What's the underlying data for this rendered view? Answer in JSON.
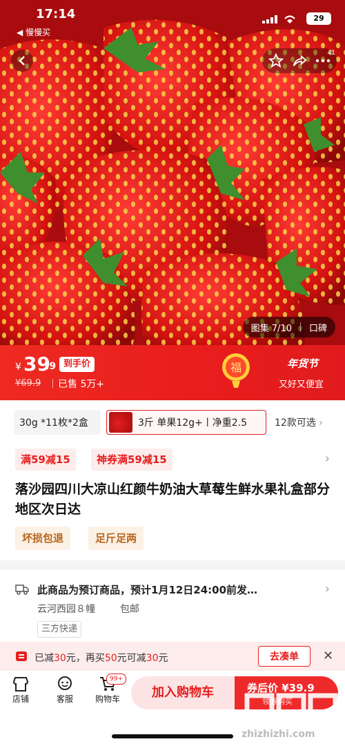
{
  "status_bar": {
    "time": "17:14",
    "back_app": "◀ 慢慢买",
    "battery": "29"
  },
  "nav": {
    "back_icon": "chevron-left-icon",
    "star_icon": "star-icon",
    "share_icon": "share-icon",
    "more_icon": "more-icon",
    "badge": "41"
  },
  "gallery": {
    "label": "图集 7/10",
    "reputation": "口碑"
  },
  "price": {
    "currency": "¥",
    "main": "39",
    "decimal": ".9",
    "to_hand_label": "到手价",
    "original": "¥69.9",
    "sold": "已售 5万+",
    "fu_char": "福",
    "festival_title": "年货节",
    "festival_sub": "又好又便宜"
  },
  "variants": {
    "option1": "30g *11枚*2盒",
    "option2": "3斤 单果12g+丨净重2.5",
    "more": "12款可选"
  },
  "coupons": [
    "满59减15",
    "神券满59减15"
  ],
  "product_title": "落沙园四川大凉山红颜牛奶油大草莓生鲜水果礼盒部分地区次日达",
  "tags": [
    "坏损包退",
    "足斤足两"
  ],
  "shipping": {
    "text": "此商品为预订商品，预计1月12日24:00前发…",
    "location": "云河西园８幢",
    "free": "包邮",
    "carrier": "三方快递"
  },
  "promo": {
    "p1": "已减",
    "a1": "30",
    "p2": "元，再买",
    "a2": "50",
    "p3": "元可减",
    "a3": "30",
    "p4": "元",
    "button": "去凑单"
  },
  "bottom": {
    "store": "店铺",
    "service": "客服",
    "cart": "购物车",
    "cart_badge": "99+",
    "add_cart": "加入购物车",
    "buy_label": "券后价 ¥39.9",
    "buy_sub": "领券购买"
  },
  "watermark": {
    "text": "zhizhizhi.com"
  },
  "colors": {
    "accent": "#e81d1d",
    "tag_text": "#b5651d",
    "promo_bg": "#fdecec"
  }
}
